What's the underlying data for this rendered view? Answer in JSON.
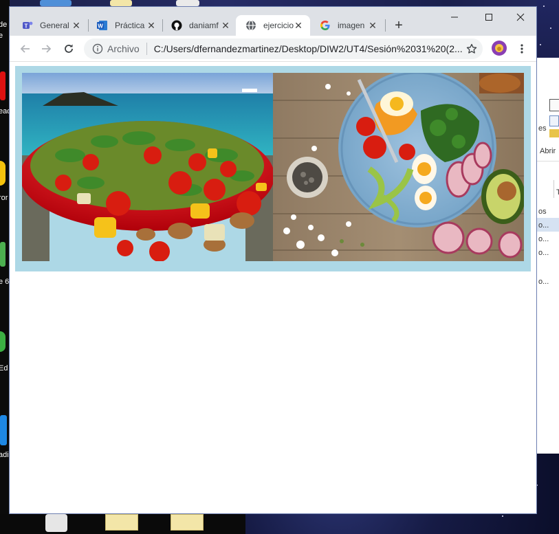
{
  "desktop": {
    "left_labels": [
      "de",
      "e",
      "ead",
      "ror",
      "e 6",
      "Ed",
      "adi"
    ],
    "right_window": {
      "labels": [
        "es",
        "Abrir",
        "T",
        "os",
        "o...",
        "o...",
        "o...",
        "o..."
      ]
    }
  },
  "browser": {
    "tabs": [
      {
        "title": "General",
        "favicon": "teams-icon",
        "active": false
      },
      {
        "title": "Práctica",
        "favicon": "word-icon",
        "active": false
      },
      {
        "title": "daniamf",
        "favicon": "github-icon",
        "active": false
      },
      {
        "title": "ejercicio",
        "favicon": "globe-icon",
        "active": true
      },
      {
        "title": "imagen",
        "favicon": "google-icon",
        "active": false
      }
    ],
    "new_tab_label": "+",
    "address": {
      "chip": "Archivo",
      "url": "C:/Users/dfernandezmartinez/Desktop/DIW2/UT4/Sesión%2031%20(2..."
    }
  },
  "page": {
    "background": "#add8e6",
    "images": [
      {
        "name": "salad-bowl-sea-photo",
        "description_icon": "image-icon"
      },
      {
        "name": "salad-plate-wood-photo",
        "description_icon": "image-icon"
      }
    ]
  }
}
